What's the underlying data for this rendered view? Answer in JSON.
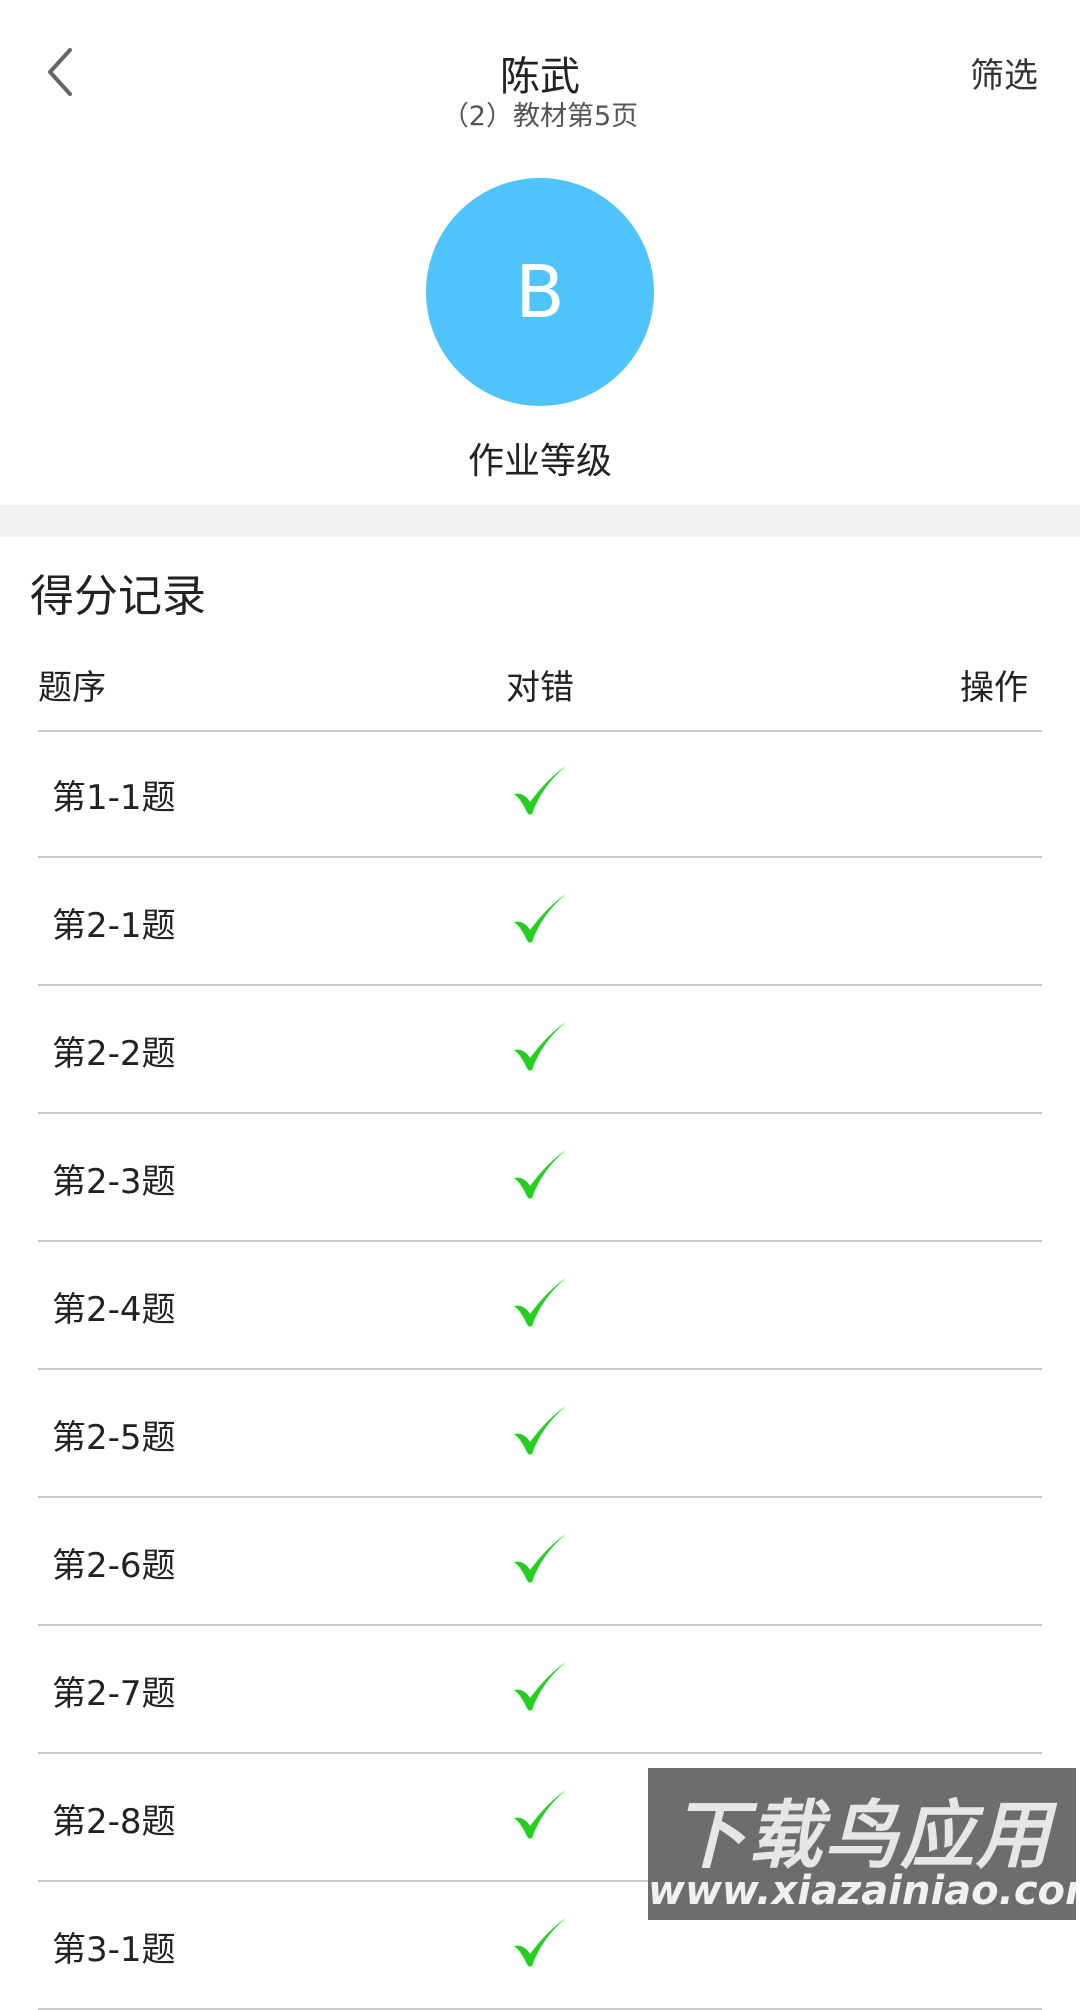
{
  "header": {
    "title": "陈武",
    "subtitle": "（2）教材第5页",
    "filter_label": "筛选"
  },
  "grade": {
    "letter": "B",
    "label": "作业等级",
    "color": "#4fc3fc"
  },
  "section_title": "得分记录",
  "table": {
    "columns": [
      "题序",
      "对错",
      "操作"
    ],
    "rows": [
      {
        "label": "第1-1题",
        "correct": true,
        "action": ""
      },
      {
        "label": "第2-1题",
        "correct": true,
        "action": ""
      },
      {
        "label": "第2-2题",
        "correct": true,
        "action": ""
      },
      {
        "label": "第2-3题",
        "correct": true,
        "action": ""
      },
      {
        "label": "第2-4题",
        "correct": true,
        "action": ""
      },
      {
        "label": "第2-5题",
        "correct": true,
        "action": ""
      },
      {
        "label": "第2-6题",
        "correct": true,
        "action": ""
      },
      {
        "label": "第2-7题",
        "correct": true,
        "action": ""
      },
      {
        "label": "第2-8题",
        "correct": true,
        "action": ""
      },
      {
        "label": "第3-1题",
        "correct": true,
        "action": ""
      }
    ],
    "check_color": "#22d11f"
  },
  "watermark": {
    "title": "下载鸟应用",
    "url": "www.xiazainiao.com"
  }
}
